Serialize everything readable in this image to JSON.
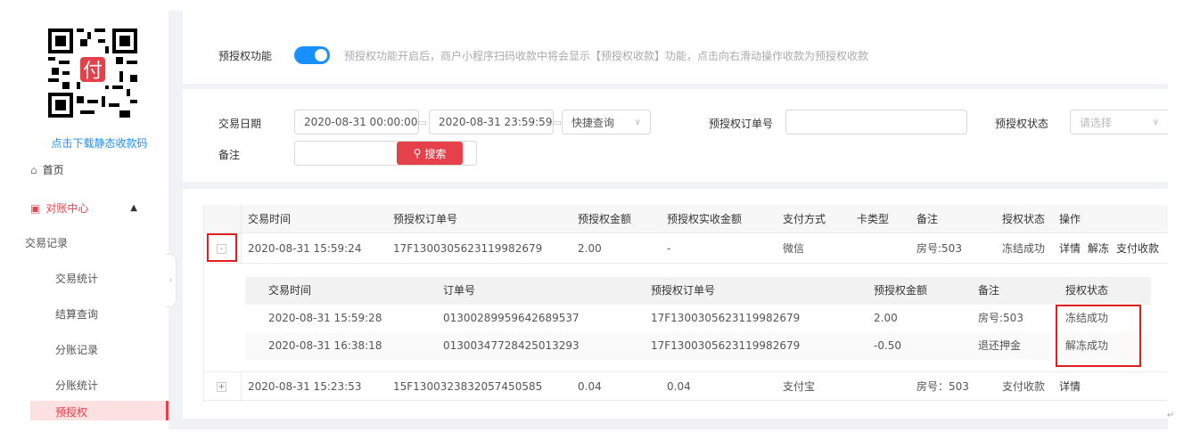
{
  "sidebar": {
    "qr_badge": "付",
    "qr_caption": "点击下载静态收款码",
    "home": "首页",
    "reconcile_center": "对账中心",
    "items": [
      "交易记录",
      "交易统计",
      "结算查询",
      "分账记录",
      "分账统计",
      "预授权"
    ]
  },
  "preauth": {
    "label": "预授权功能",
    "hint": "预授权功能开启后，商户小程序扫码收款中将会显示【预授权收款】功能，点击向右滑动操作收款为预授权收款"
  },
  "filters": {
    "trade_date_label": "交易日期",
    "start": "2020-08-31 00:00:00",
    "end": "2020-08-31 23:59:59",
    "quick_query": "快捷查询",
    "order_label": "预授权订单号",
    "status_label": "预授权状态",
    "status_placeholder": "请选择",
    "remark_label": "备注",
    "search_button": "搜索"
  },
  "table": {
    "headers": [
      "交易时间",
      "预授权订单号",
      "预授权金额",
      "预授权实收金额",
      "支付方式",
      "卡类型",
      "备注",
      "授权状态",
      "操作"
    ],
    "rows": [
      {
        "expander": "-",
        "time": "2020-08-31 15:59:24",
        "order": "17F1300305623119982679",
        "amount": "2.00",
        "received": "-",
        "pay": "微信",
        "card": "",
        "remark": "房号:503",
        "status": "冻结成功",
        "ops": [
          "详情",
          "解冻",
          "支付收款"
        ]
      },
      {
        "expander": "+",
        "time": "2020-08-31 15:23:53",
        "order": "15F1300323832057450585",
        "amount": "0.04",
        "received": "0.04",
        "pay": "支付宝",
        "card": "",
        "remark": "房号：503",
        "status": "支付收款",
        "ops": [
          "详情"
        ]
      }
    ]
  },
  "subtable": {
    "headers": [
      "交易时间",
      "订单号",
      "预授权订单号",
      "预授权金额",
      "备注",
      "授权状态"
    ],
    "rows": [
      {
        "time": "2020-08-31 15:59:28",
        "order": "01300289959642689537",
        "preorder": "17F1300305623119982679",
        "amount": "2.00",
        "remark": "房号:503",
        "status": "冻结成功"
      },
      {
        "time": "2020-08-31 16:38:18",
        "order": "01300347728425013293",
        "preorder": "17F1300305623119982679",
        "amount": "-0.50",
        "remark": "退还押金",
        "status": "解冻成功"
      }
    ]
  },
  "colors": {
    "accent": "#e6404b",
    "toggle": "#1890ff",
    "highlight_box": "#e02020"
  }
}
